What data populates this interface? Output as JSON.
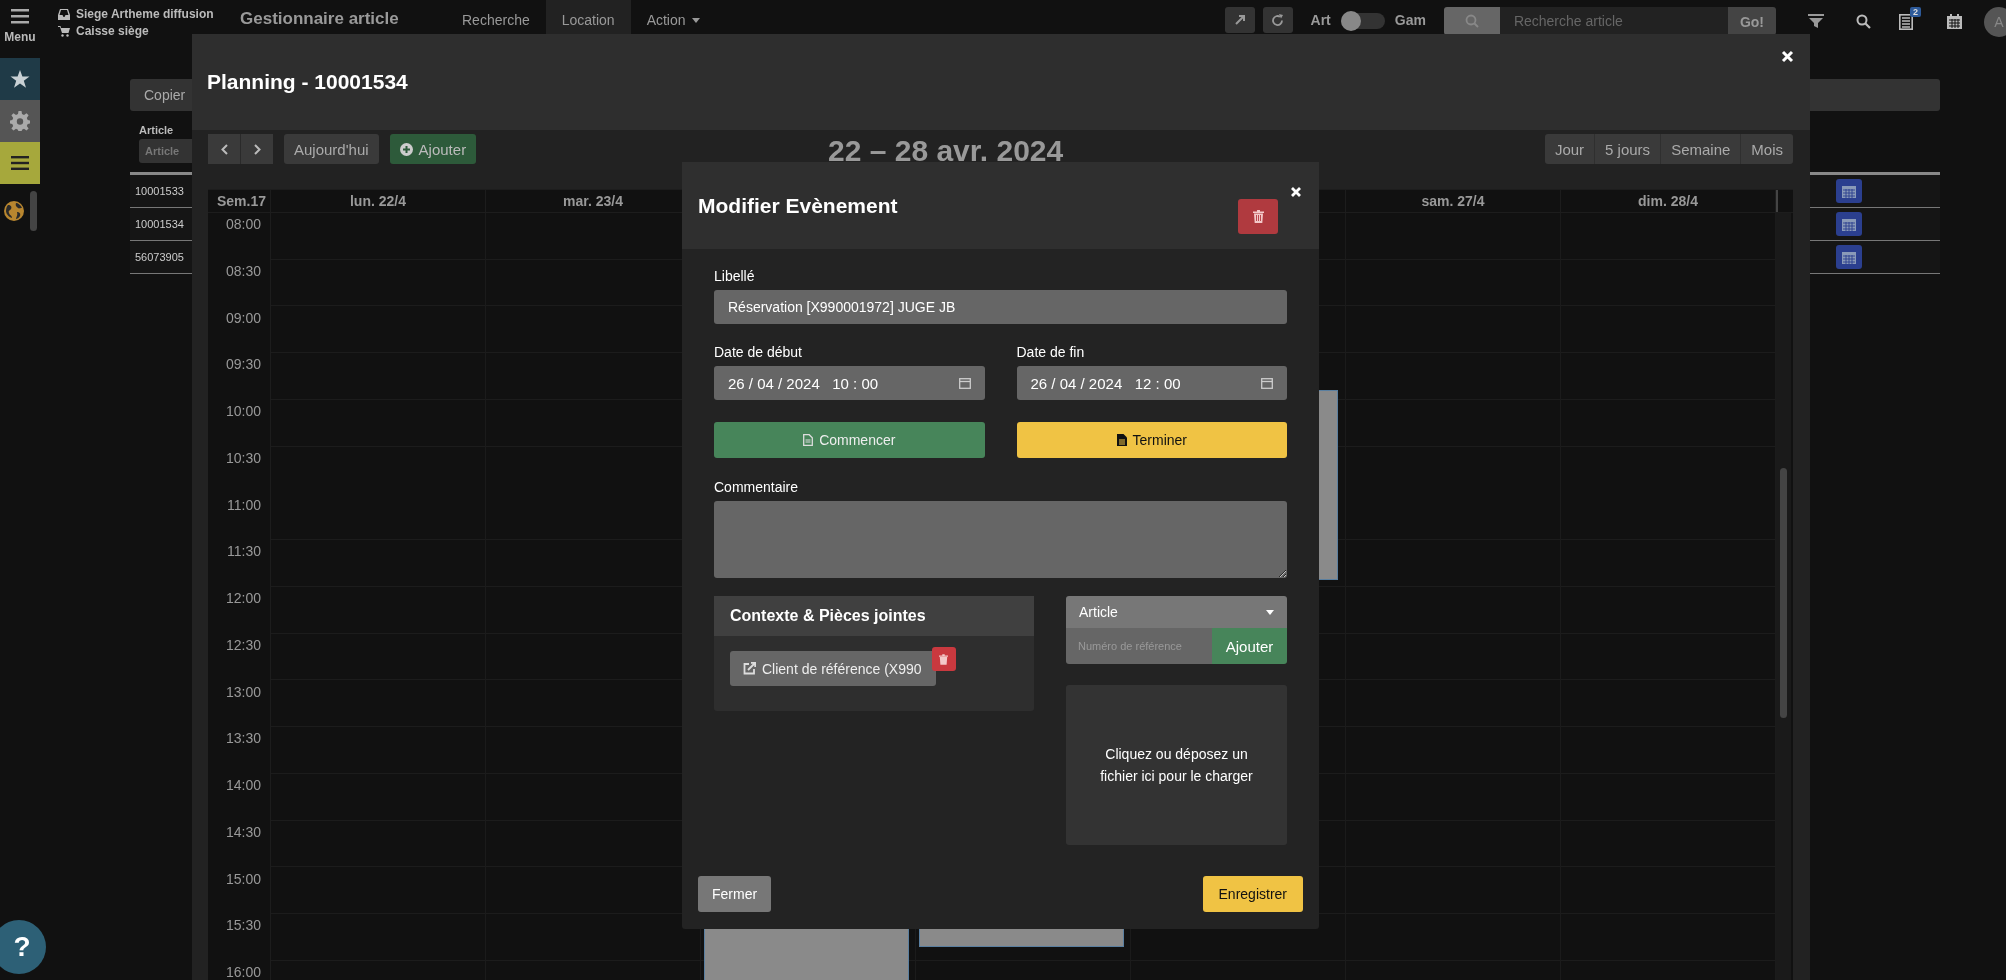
{
  "top_bar": {
    "menu_label": "Menu",
    "site": "Siege Artheme diffusion",
    "register": "Caisse siège",
    "title": "Gestionnaire article",
    "nav": [
      {
        "label": "Recherche",
        "selected": false
      },
      {
        "label": "Location",
        "selected": true
      },
      {
        "label": "Action",
        "selected": false
      }
    ],
    "toggle": {
      "left_label": "Art",
      "right_label": "Gam",
      "on": false
    },
    "search": {
      "placeholder": "Recherche article",
      "button": "Go!"
    },
    "notification_count": "2",
    "avatar": "A"
  },
  "background": {
    "toolbar_button": "Copier",
    "column": "Article",
    "filter_placeholder": "Article",
    "rows": [
      "10001533",
      "10001534",
      "56073905"
    ]
  },
  "help_label": "?",
  "planning": {
    "title": "Planning - 10001534",
    "today": "Aujourd'hui",
    "add": "Ajouter",
    "range": "22 – 28 avr. 2024",
    "views": [
      "Jour",
      "5 jours",
      "Semaine",
      "Mois"
    ],
    "week": "Sem.17",
    "days_before": [
      "lun. 22/4",
      "mar. 23/4"
    ],
    "days_after": [
      "sam. 27/4",
      "dim. 28/4"
    ],
    "times": [
      "08:00",
      "08:30",
      "09:00",
      "09:30",
      "10:00",
      "10:30",
      "11:00",
      "11:30",
      "12:00",
      "12:30",
      "13:00",
      "13:30",
      "14:00",
      "14:30",
      "15:00",
      "15:30",
      "16:00"
    ]
  },
  "event_modal": {
    "title": "Modifier Evènement",
    "label_label": "Libellé",
    "label_value": "Réservation [X990001972] JUGE JB",
    "start_label": "Date de début",
    "start_value": "26 / 04 / 2024   10 : 00",
    "end_label": "Date de fin",
    "end_value": "26 / 04 / 2024   12 : 00",
    "start_button": "Commencer",
    "finish_button": "Terminer",
    "comment_label": "Commentaire",
    "attachments": {
      "title": "Contexte & Pièces jointes",
      "items": [
        "Client de référence (X990"
      ]
    },
    "reference": {
      "type_label": "Article",
      "placeholder": "Numéro de référence",
      "button": "Ajouter"
    },
    "dropzone": "Cliquez ou déposez un fichier ici pour le charger",
    "close_button": "Fermer",
    "save_button": "Enregistrer"
  }
}
